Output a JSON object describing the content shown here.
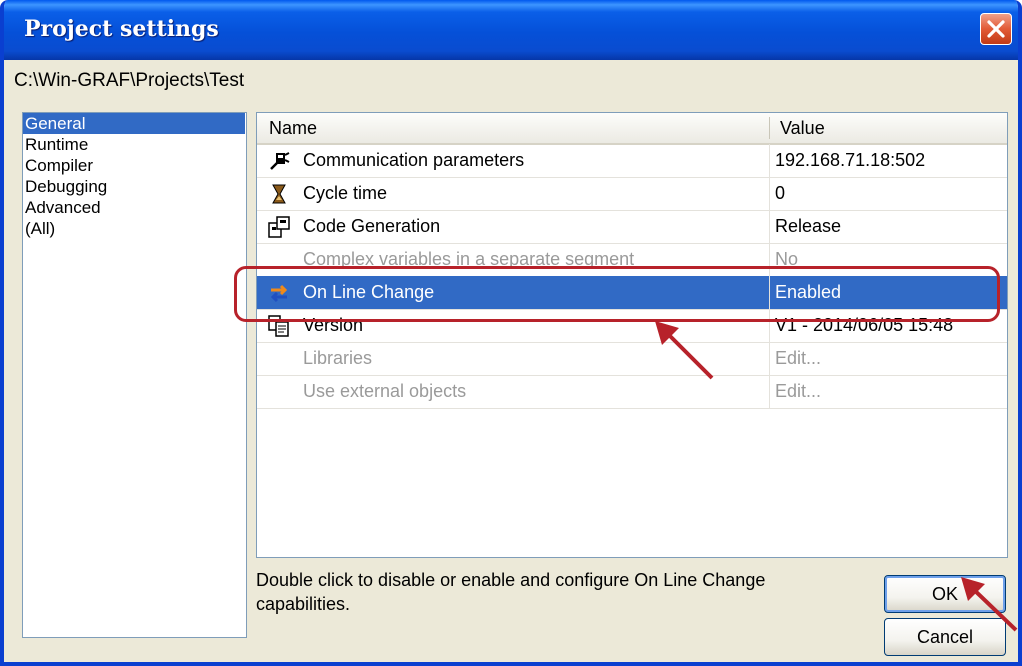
{
  "window": {
    "title": "Project settings"
  },
  "path": "C:\\Win-GRAF\\Projects\\Test",
  "categories": [
    {
      "label": "General",
      "selected": true
    },
    {
      "label": "Runtime",
      "selected": false
    },
    {
      "label": "Compiler",
      "selected": false
    },
    {
      "label": "Debugging",
      "selected": false
    },
    {
      "label": "Advanced",
      "selected": false
    },
    {
      "label": "(All)",
      "selected": false
    }
  ],
  "grid": {
    "columns": {
      "name": "Name",
      "value": "Value"
    },
    "rows": [
      {
        "name": "Communication parameters",
        "value": "192.168.71.18:502",
        "icon": "communication-icon",
        "state": "normal"
      },
      {
        "name": "Cycle time",
        "value": "0",
        "icon": "cycle-time-icon",
        "state": "normal"
      },
      {
        "name": "Code Generation",
        "value": "Release",
        "icon": "code-generation-icon",
        "state": "normal"
      },
      {
        "name": "Complex variables in a separate segment",
        "value": "No",
        "icon": "",
        "state": "disabled"
      },
      {
        "name": "On Line Change",
        "value": "Enabled",
        "icon": "online-change-icon",
        "state": "selected"
      },
      {
        "name": "Version",
        "value": "V1 - 2014/06/05 15:48",
        "icon": "version-icon",
        "state": "normal"
      },
      {
        "name": "Libraries",
        "value": "Edit...",
        "icon": "",
        "state": "disabled"
      },
      {
        "name": "Use external objects",
        "value": "Edit...",
        "icon": "",
        "state": "disabled"
      }
    ]
  },
  "description": "Double click to disable or enable and configure On Line Change capabilities.",
  "buttons": {
    "ok": "OK",
    "cancel": "Cancel"
  },
  "colors": {
    "selection": "#316ac5",
    "annotation": "#b7222a",
    "titlebar": "#0a5fe8"
  }
}
